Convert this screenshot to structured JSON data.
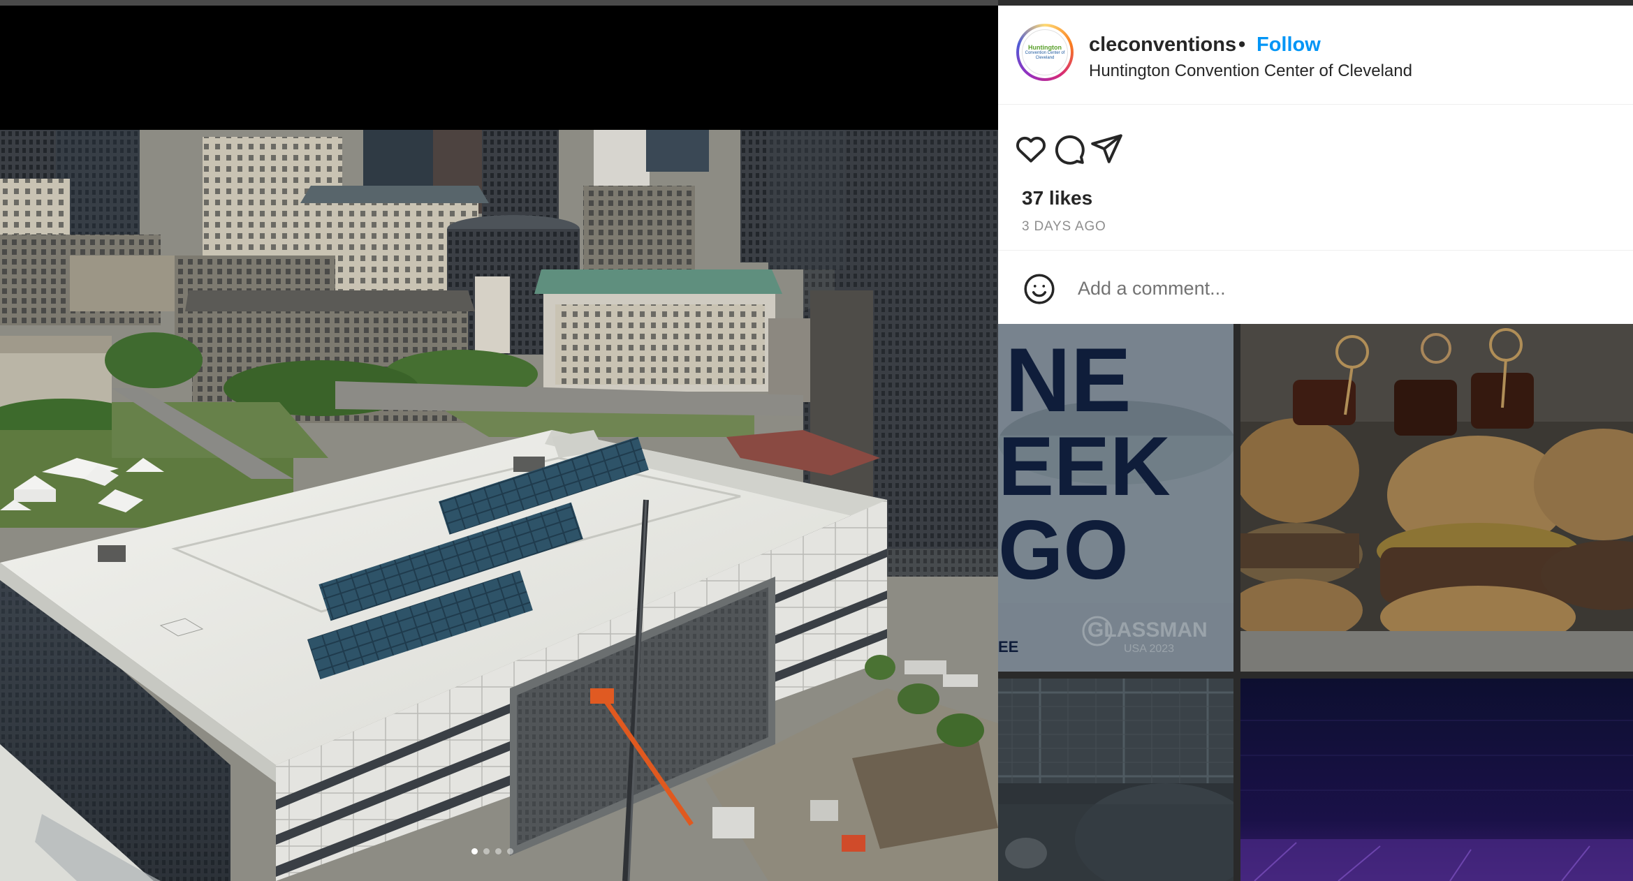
{
  "post": {
    "username": "cleconventions",
    "separator": "•",
    "follow_label": "Follow",
    "location": "Huntington Convention Center of Cleveland",
    "avatar_logo_line1": "Huntington",
    "avatar_logo_line2": "Convention Center of Cleveland",
    "likes": "37 likes",
    "time_ago": "3 DAYS AGO",
    "comment_placeholder": "Add a comment...",
    "media_description_icon": "photo-aerial-convention-center",
    "carousel": {
      "count": 4,
      "active_index": 0
    }
  },
  "icons": {
    "like": "heart-icon",
    "comment": "comment-bubble-icon",
    "share": "paper-plane-icon",
    "emoji": "smiley-icon"
  },
  "thumbnails": [
    {
      "name": "thumb-one-week-ago",
      "lines": [
        "NE",
        "EEK",
        "GO"
      ],
      "footer_brand": "GLASSMAN",
      "footer_sub": "USA 2023",
      "footer_left": "EE"
    },
    {
      "name": "thumb-sliders-food"
    },
    {
      "name": "thumb-fence-rooftop"
    },
    {
      "name": "thumb-purple-event-hall"
    }
  ],
  "colors": {
    "follow_blue": "#0095f6",
    "text_dark": "#262626",
    "text_muted": "#8e8e8e",
    "separator": "#efefef"
  }
}
